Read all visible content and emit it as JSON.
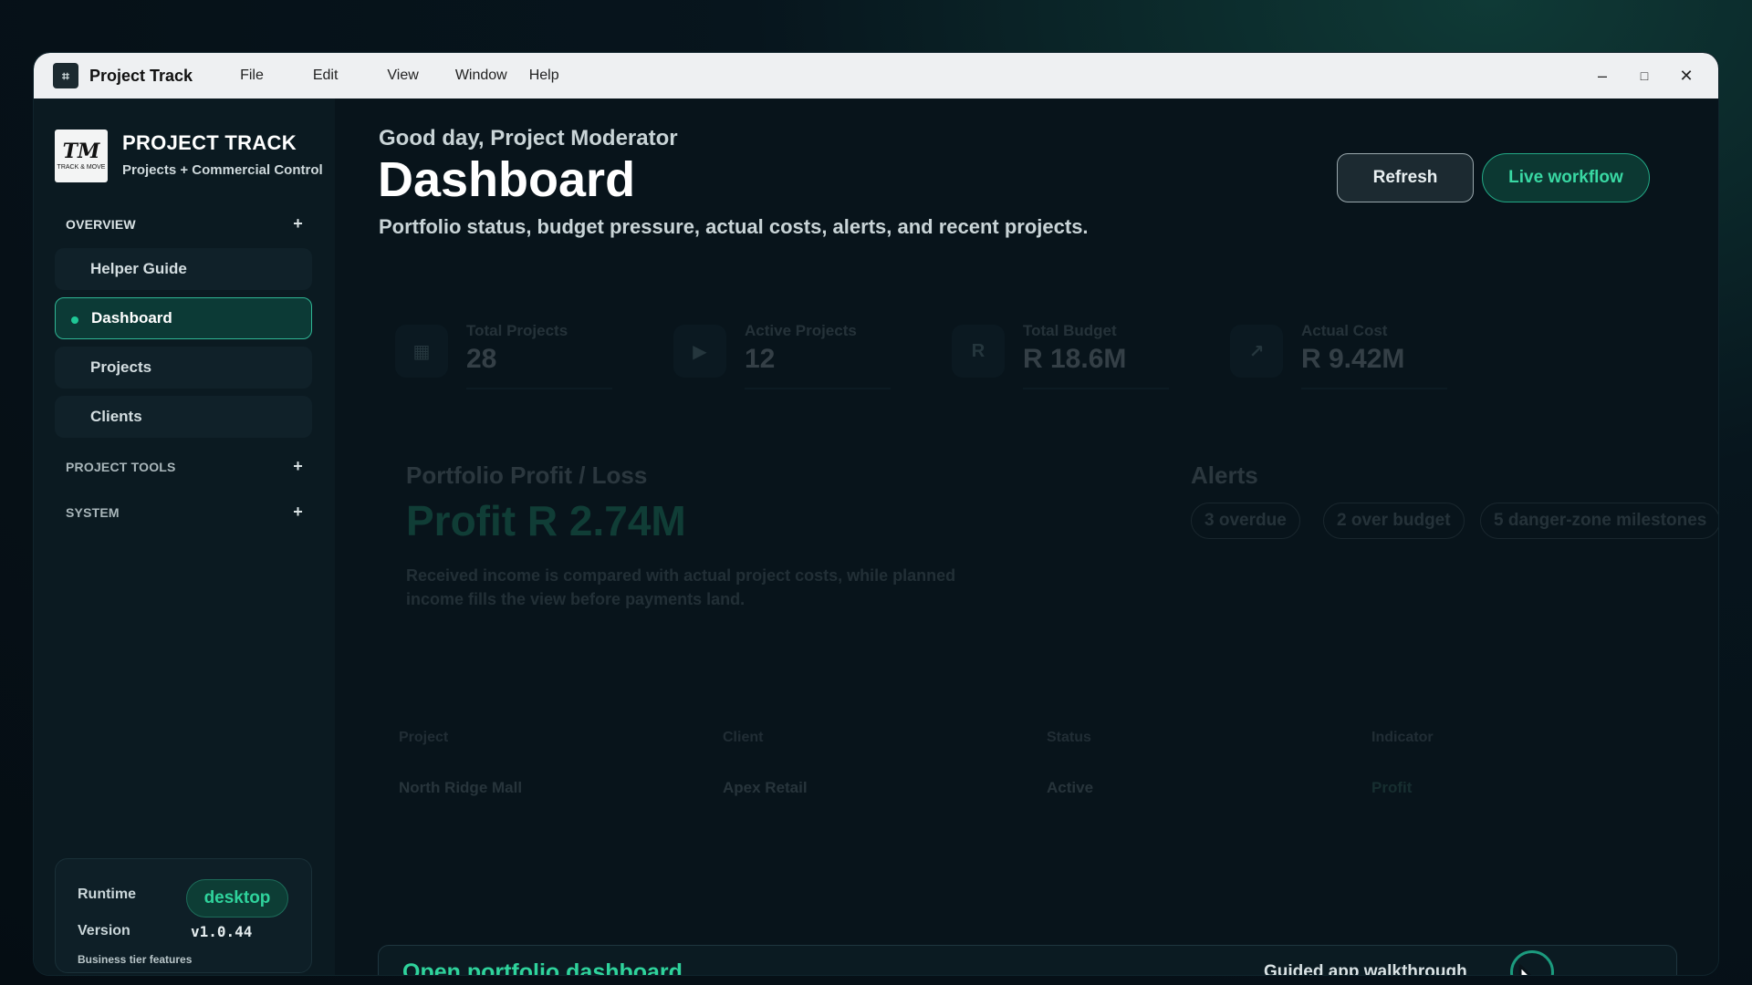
{
  "titlebar": {
    "app_title": "Project Track",
    "menu": [
      "File",
      "Edit",
      "View",
      "Window",
      "Help"
    ],
    "controls": {
      "minimize": "–",
      "maximize": "□",
      "close": "✕"
    }
  },
  "sidebar": {
    "brand_name": "PROJECT TRACK",
    "brand_tagline": "Projects + Commercial Control",
    "logo_text": "TM",
    "logo_sub": "TRACK & MOVE",
    "sections": {
      "overview": "OVERVIEW",
      "project_tools": "PROJECT TOOLS",
      "system": "SYSTEM"
    },
    "items": [
      "Helper Guide",
      "Dashboard",
      "Projects",
      "Clients"
    ],
    "active_item": "Dashboard",
    "runtime": {
      "runtime_label": "Runtime",
      "runtime_value": "desktop",
      "version_label": "Version",
      "version_value": "v1.0.44",
      "footer": "Business tier features"
    }
  },
  "main": {
    "greeting": "Good day, Project Moderator",
    "title": "Dashboard",
    "subtitle": "Portfolio status, budget pressure, actual costs, alerts, and recent projects.",
    "buttons": {
      "refresh": "Refresh",
      "live_workflow": "Live workflow"
    },
    "stats": [
      {
        "label": "Total Projects",
        "value": "28",
        "icon": "grid-icon"
      },
      {
        "label": "Active Projects",
        "value": "12",
        "icon": "play-icon"
      },
      {
        "label": "Total Budget",
        "value": "R 18.6M",
        "icon": "rand-icon"
      },
      {
        "label": "Actual Cost",
        "value": "R 9.42M",
        "icon": "trend-arrow-icon"
      }
    ],
    "profit_loss": {
      "title": "Portfolio Profit / Loss",
      "value": "Profit R 2.74M",
      "description": "Received income is compared with actual project costs, while planned income fills the view before payments land."
    },
    "alerts": {
      "title": "Alerts",
      "pills": [
        "3 overdue",
        "2 over budget",
        "5 danger-zone milestones"
      ]
    },
    "table": {
      "headers": [
        "Project",
        "Client",
        "Status",
        "Indicator"
      ],
      "rows": [
        [
          "North Ridge Mall",
          "Apex Retail",
          "Active",
          "Profit"
        ]
      ]
    },
    "cta": {
      "open_label": "Open portfolio dashboard",
      "guide_label": "Guided app walkthrough"
    }
  },
  "colors": {
    "accent": "#2fd39c",
    "background": "#08141b",
    "sidebar": "#0b1a21",
    "titlebar": "#eef0f2"
  }
}
